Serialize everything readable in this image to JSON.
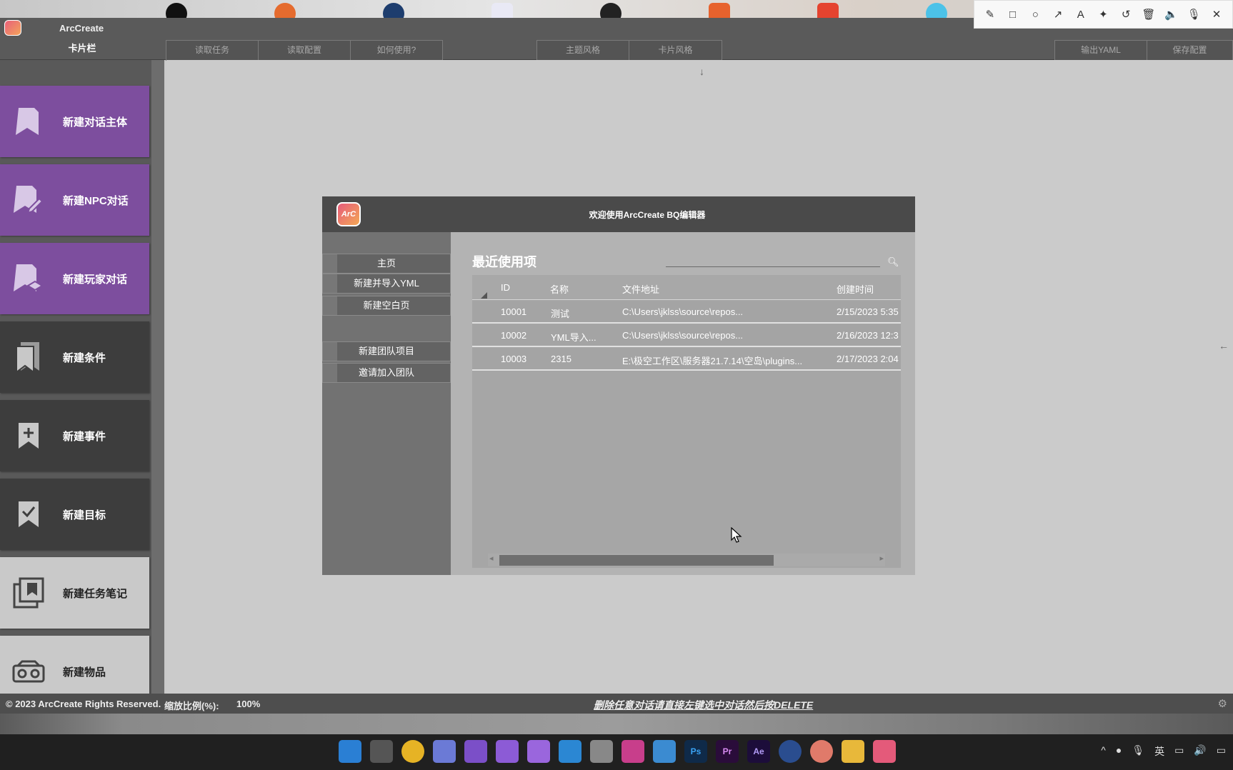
{
  "app": {
    "title": "ArcCreate"
  },
  "menubar": {
    "cardbar_label": "卡片栏",
    "left_buttons": [
      "读取任务",
      "读取配置",
      "如何使用?"
    ],
    "center_buttons": [
      "主题风格",
      "卡片风格"
    ],
    "right_buttons": [
      "输出YAML",
      "保存配置"
    ]
  },
  "sidebar": {
    "cards": [
      {
        "label": "新建对话主体",
        "icon": "bookmark-icon",
        "style": "purple"
      },
      {
        "label": "新建NPC对话",
        "icon": "bookmark-edit-icon",
        "style": "purple"
      },
      {
        "label": "新建玩家对话",
        "icon": "bookmark-stack-icon",
        "style": "purple"
      },
      {
        "label": "新建条件",
        "icon": "bookmarks-icon",
        "style": "dark"
      },
      {
        "label": "新建事件",
        "icon": "bookmark-plus-icon",
        "style": "dark"
      },
      {
        "label": "新建目标",
        "icon": "bookmark-check-icon",
        "style": "dark"
      },
      {
        "label": "新建任务笔记",
        "icon": "notes-icon",
        "style": "light"
      },
      {
        "label": "新建物品",
        "icon": "radio-icon",
        "style": "light"
      }
    ]
  },
  "dialog": {
    "title": "欢迎使用ArcCreate BQ编辑器",
    "logo_text": "ArC",
    "nav_buttons_top": [
      "主页",
      "新建并导入YML",
      "新建空白页"
    ],
    "nav_buttons_bottom": [
      "新建团队项目",
      "邀请加入团队"
    ],
    "recent_title": "最近使用项",
    "search_placeholder": "",
    "columns": [
      "ID",
      "名称",
      "文件地址",
      "创建时间"
    ],
    "rows": [
      [
        "10001",
        "测试",
        "C:\\Users\\jklss\\source\\repos...",
        "2/15/2023 5:35"
      ],
      [
        "10002",
        "YML导入...",
        "C:\\Users\\jklss\\source\\repos...",
        "2/16/2023 12:3"
      ],
      [
        "10003",
        "2315",
        "E:\\极空工作区\\服务器21.7.14\\空岛\\plugins...",
        "2/17/2023 2:04"
      ]
    ]
  },
  "statusbar": {
    "copyright": "© 2023 ArcCreate Rights Reserved.",
    "zoom_label": "缩放比例(%):",
    "zoom_value": "100%",
    "hint": "删除任意对话请直接左键选中对话然后按DELETE"
  },
  "taskbar": {
    "tray_lang": "英"
  },
  "colors": {
    "card_purple": "#7d4e9e",
    "card_dark": "#3d3d3d",
    "card_light": "#c9c9c9",
    "header_dark": "#4a4a4a"
  }
}
